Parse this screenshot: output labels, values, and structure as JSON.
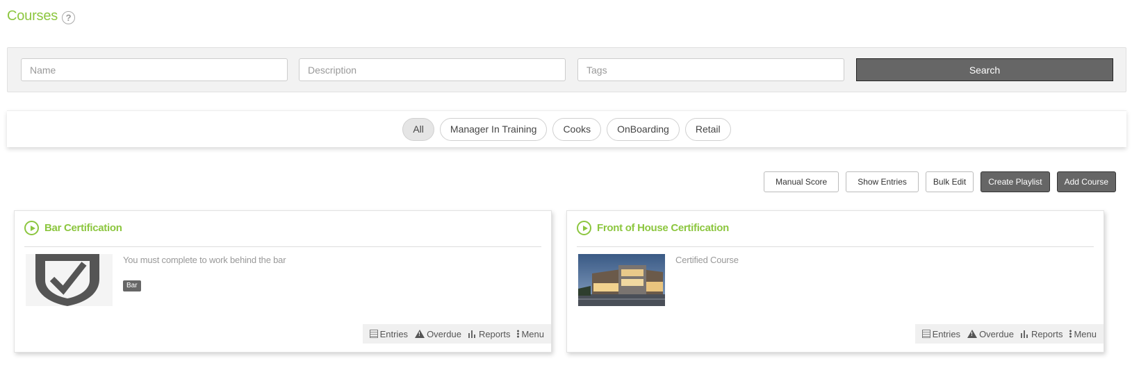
{
  "page": {
    "title": "Courses",
    "help_icon": "question-circle-icon"
  },
  "search": {
    "name_placeholder": "Name",
    "description_placeholder": "Description",
    "tags_placeholder": "Tags",
    "button_label": "Search"
  },
  "filters": {
    "items": [
      {
        "label": "All",
        "active": true
      },
      {
        "label": "Manager In Training",
        "active": false
      },
      {
        "label": "Cooks",
        "active": false
      },
      {
        "label": "OnBoarding",
        "active": false
      },
      {
        "label": "Retail",
        "active": false
      }
    ]
  },
  "actions": {
    "manual_score": "Manual Score",
    "show_entries": "Show Entries",
    "bulk_edit": "Bulk Edit",
    "create_playlist": "Create Playlist",
    "add_course": "Add Course"
  },
  "courses": [
    {
      "title": "Bar Certification",
      "description": "You must complete to work behind the bar",
      "tag": "Bar",
      "thumbnail": "shield-check-icon"
    },
    {
      "title": "Front of House Certification",
      "description": "Certified Course",
      "tag": "",
      "thumbnail": "building-photo"
    }
  ],
  "card_footer": {
    "entries": "Entries",
    "overdue": "Overdue",
    "reports": "Reports",
    "menu": "Menu"
  },
  "colors": {
    "accent": "#8cc63f",
    "dark_button": "#666666"
  }
}
